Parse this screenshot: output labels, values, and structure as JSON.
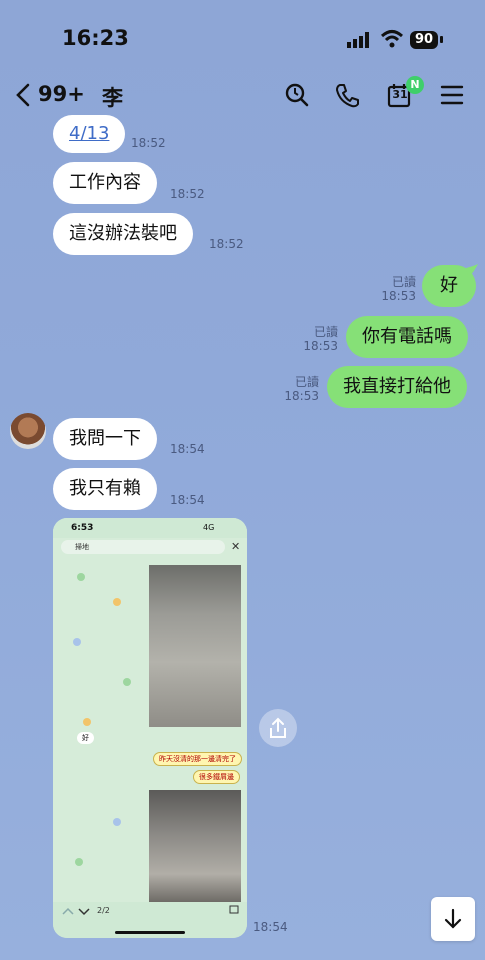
{
  "status_bar": {
    "time": "16:23",
    "battery": "90"
  },
  "header": {
    "unread_count": "99+",
    "contact_name": "李",
    "calendar_day": "31",
    "calendar_badge": "N"
  },
  "messages": [
    {
      "text": "4/13",
      "time": "18:52",
      "side": "received",
      "is_link": true
    },
    {
      "text": "工作內容",
      "time": "18:52",
      "side": "received"
    },
    {
      "text": "這沒辦法裝吧",
      "time": "18:52",
      "side": "received"
    },
    {
      "text": "好",
      "time": "18:53",
      "side": "sent",
      "read": "已讀"
    },
    {
      "text": "你有電話嗎",
      "time": "18:53",
      "side": "sent",
      "read": "已讀"
    },
    {
      "text": "我直接打給他",
      "time": "18:53",
      "side": "sent",
      "read": "已讀"
    },
    {
      "text": "我問一下",
      "time": "18:54",
      "side": "received"
    },
    {
      "text": "我只有賴",
      "time": "18:54",
      "side": "received"
    }
  ],
  "image_message": {
    "time": "18:54",
    "inner_screenshot": {
      "time": "6:53",
      "status_right": "4G",
      "search_text": "掃地",
      "bubble_1": "昨天沒清的那一邊清完了",
      "bubble_2": "很多鐵屑邊",
      "reply": "好",
      "page_indicator": "2/2"
    }
  },
  "icons": {
    "back": "chevron-left-icon",
    "search": "search-icon",
    "call": "phone-icon",
    "calendar": "calendar-icon",
    "menu": "menu-icon",
    "share": "share-icon",
    "scroll_down": "arrow-down-icon"
  }
}
